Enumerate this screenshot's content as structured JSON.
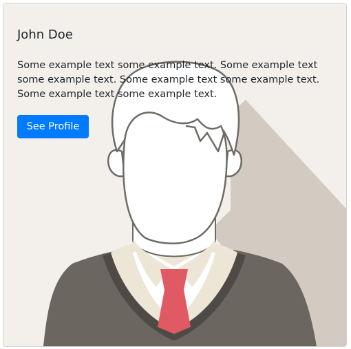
{
  "card": {
    "title": "John Doe",
    "text": "Some example text some example text. Some example text some example text. Some example text some example text. Some example text some example text.",
    "button_label": "See Profile",
    "image_icon": "male-avatar-illustration",
    "colors": {
      "card_background": "#f3f0ec",
      "shadow": "#d3cbc2",
      "sweater": "#6b6760",
      "collar": "#ede5d6",
      "tie": "#e05a64",
      "button": "#007bff",
      "button_text": "#ffffff",
      "text": "#212529"
    }
  }
}
